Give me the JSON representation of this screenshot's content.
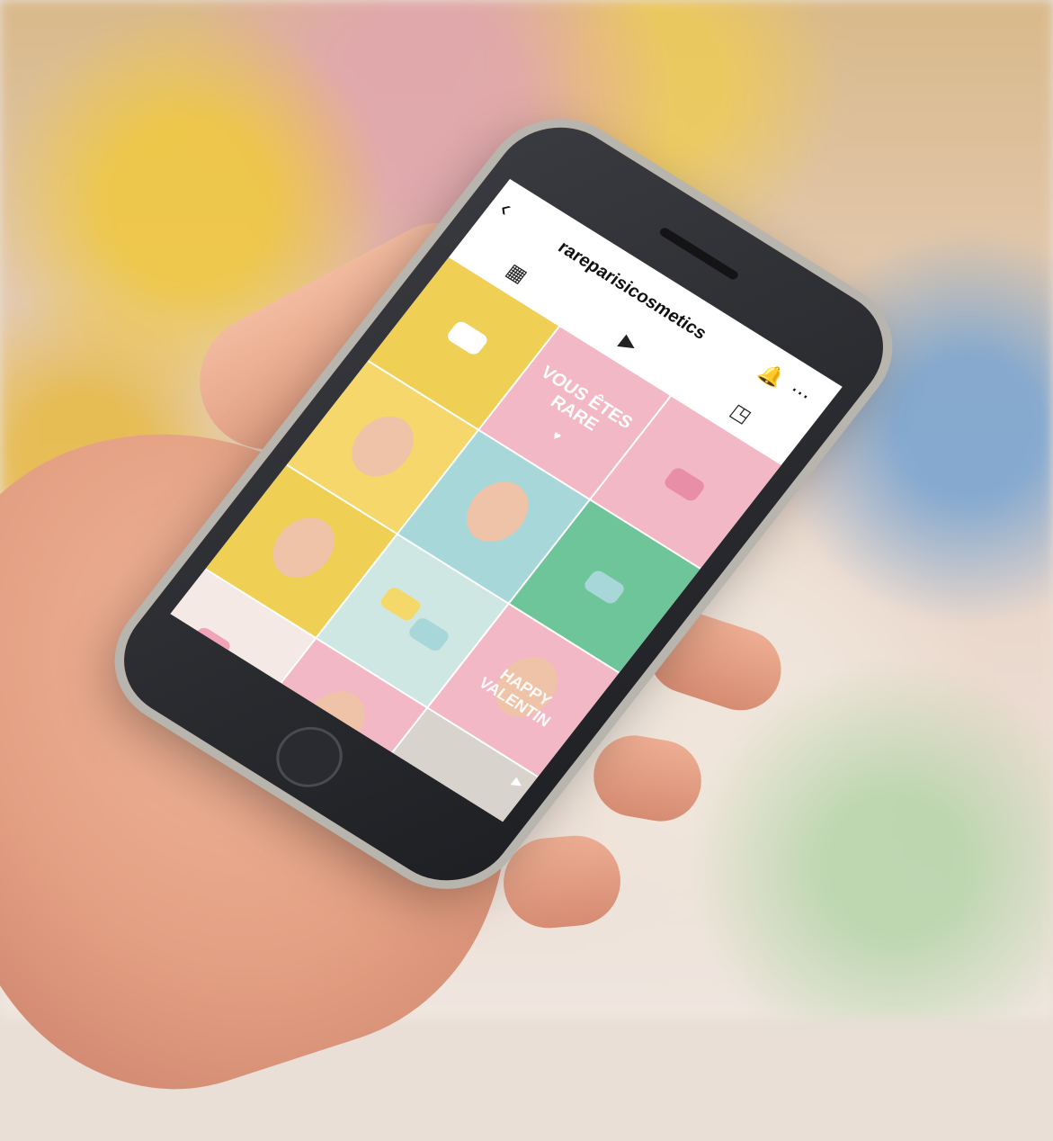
{
  "app": {
    "username": "rareparisicosmetics",
    "colors": {
      "screen_bg": "#ffffff",
      "pink": "#f2b8c6",
      "yellow": "#f0cf55",
      "mint": "#6fc59a",
      "aqua": "#a7d7d8",
      "dark": "#1e2426"
    }
  },
  "header": {
    "back_icon": "back-chevron-icon",
    "title": "rareparisicosmetics",
    "bell_icon": "bell-icon",
    "more_icon": "more-icon"
  },
  "tabs": [
    {
      "name": "grid-tab",
      "icon": "grid-icon"
    },
    {
      "name": "reels-tab",
      "icon": "reels-icon"
    },
    {
      "name": "tagged-tab",
      "icon": "tagged-icon"
    }
  ],
  "posts": [
    {
      "id": "p1",
      "bg": "#f0cf55"
    },
    {
      "id": "p2",
      "bg": "#f2b8c6",
      "text": "VOUS ÊTES RARE"
    },
    {
      "id": "p3",
      "bg": "#f2b8c6"
    },
    {
      "id": "p4",
      "bg": "#f5d76b"
    },
    {
      "id": "p5",
      "bg": "#a7d7d8"
    },
    {
      "id": "p6",
      "bg": "#6fc59a"
    },
    {
      "id": "p7",
      "bg": "#f0cf55"
    },
    {
      "id": "p8",
      "bg": "#cfe7e2"
    },
    {
      "id": "p9",
      "bg": "#f2b8c6",
      "text": "HAPPY VALENTIN"
    },
    {
      "id": "p10",
      "bg": "#f5e9e6"
    },
    {
      "id": "p11",
      "bg": "#f2b8c6"
    },
    {
      "id": "p12",
      "bg": "#d8d3cd"
    },
    {
      "id": "p13",
      "bg": "#1e2426"
    },
    {
      "id": "p14",
      "bg": "#f3ecdf"
    },
    {
      "id": "p15",
      "bg": "#f0e4de"
    }
  ]
}
